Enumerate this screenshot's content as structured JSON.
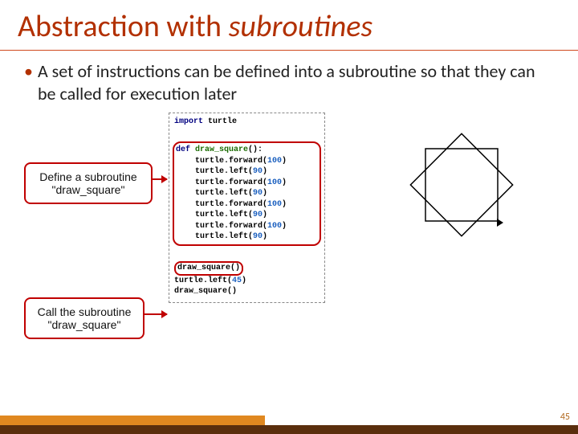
{
  "title_part1": "Abstraction with ",
  "title_part2": "subroutines",
  "bullet_text": "A set of instructions can be defined into a subroutine so that they can be called for execution later",
  "callout1_line1": "Define a subroutine",
  "callout1_line2": "\"draw_square\"",
  "callout2_line1": "Call the subroutine",
  "callout2_line2": "\"draw_square\"",
  "page_number": "45",
  "code": {
    "import_kw": "import",
    "import_mod": " turtle",
    "def_kw": "def",
    "def_name": " draw_square",
    "def_paren": "():",
    "body": [
      {
        "pre": "    turtle.forward(",
        "num": "100",
        "post": ")"
      },
      {
        "pre": "    turtle.left(",
        "num": "90",
        "post": ")"
      },
      {
        "pre": "    turtle.forward(",
        "num": "100",
        "post": ")"
      },
      {
        "pre": "    turtle.left(",
        "num": "90",
        "post": ")"
      },
      {
        "pre": "    turtle.forward(",
        "num": "100",
        "post": ")"
      },
      {
        "pre": "    turtle.left(",
        "num": "90",
        "post": ")"
      },
      {
        "pre": "    turtle.forward(",
        "num": "100",
        "post": ")"
      },
      {
        "pre": "    turtle.left(",
        "num": "90",
        "post": ")"
      }
    ],
    "call1": "draw_square()",
    "call2_pre": "turtle.left(",
    "call2_num": "45",
    "call2_post": ")",
    "call3": "draw_square()"
  }
}
